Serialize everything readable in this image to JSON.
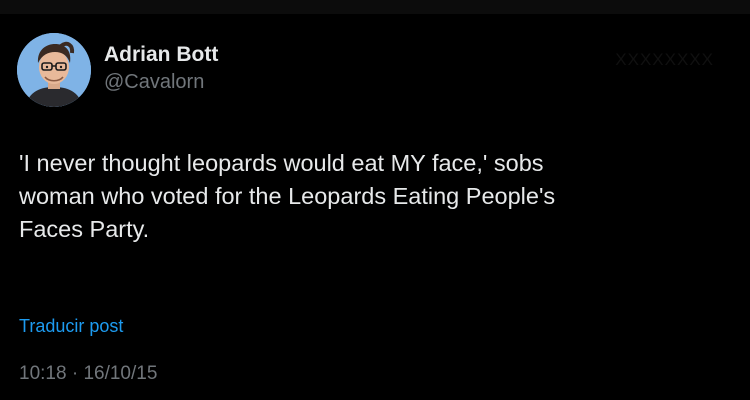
{
  "tweet": {
    "author": {
      "display_name": "Adrian Bott",
      "handle": "@Cavalorn"
    },
    "watermark": "XXXXXXXX",
    "text": "'I never thought leopards would eat MY face,' sobs\nwoman who voted for the Leopards Eating People's\nFaces Party.",
    "translate_label": "Traducir post",
    "time": "10:18",
    "separator": "·",
    "date": "16/10/15"
  },
  "colors": {
    "background": "#000000",
    "primary_text": "#e7e9ea",
    "secondary_text": "#71767b",
    "link": "#1d9bf0"
  }
}
